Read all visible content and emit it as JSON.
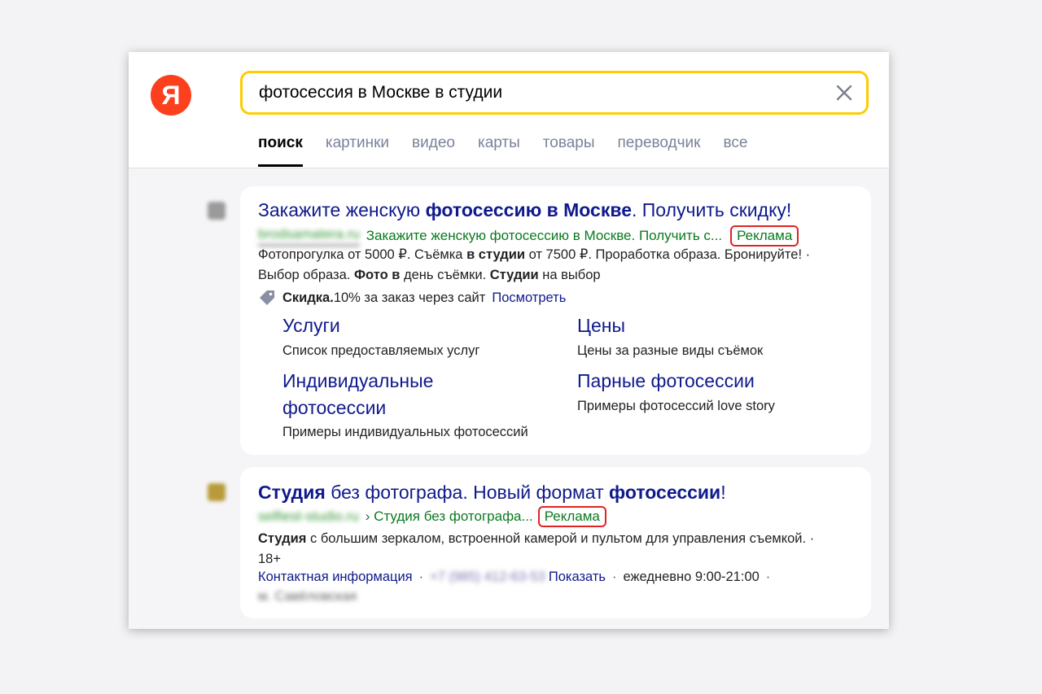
{
  "logo": {
    "letter": "Я"
  },
  "search": {
    "query": "фотосессия в Москве в студии"
  },
  "tabs": [
    {
      "label": "поиск"
    },
    {
      "label": "картинки"
    },
    {
      "label": "видео"
    },
    {
      "label": "карты"
    },
    {
      "label": "товары"
    },
    {
      "label": "переводчик"
    },
    {
      "label": "все"
    }
  ],
  "result1": {
    "title_a": "Закажите женскую ",
    "title_b": "фотосессию в Москве",
    "title_c": ". Получить скидку!",
    "domain": "brodsamatera.ru",
    "url_text": "Закажите женскую фотосессию в Москве. Получить с...",
    "badge": "Реклама",
    "snippet_a": "Фотопрогулка от 5000 ₽. Съёмка ",
    "snippet_b": "в студии",
    "snippet_c": " от 7500 ₽. Проработка образа. Бронируйте! ·",
    "snippet_d": "Выбор образа. ",
    "snippet_e": "Фото в",
    "snippet_f": " день съёмки. ",
    "snippet_g": "Студии",
    "snippet_h": " на выбор",
    "promo_bold": "Скидка.",
    "promo_text": " 10% за заказ через сайт",
    "promo_link": "Посмотреть",
    "sitelinks": [
      {
        "title": "Услуги",
        "desc": "Список предоставляемых услуг"
      },
      {
        "title": "Цены",
        "desc": "Цены за разные виды съёмок"
      },
      {
        "title": "Индивидуальные фотосессии",
        "desc": "Примеры индивидуальных фотосессий"
      },
      {
        "title": "Парные фотосессии",
        "desc": "Примеры фотосессий love story"
      }
    ]
  },
  "result2": {
    "title_a": "Студия",
    "title_b": " без фотографа. Новый формат ",
    "title_c": "фотосессии",
    "title_d": "!",
    "domain": "selfiest-studio.ru",
    "url_text": "› Студия без фотографа...",
    "badge": "Реклама",
    "snippet_a": "Студия",
    "snippet_b": " с большим зеркалом, встроенной камерой и пультом для управления съемкой. ·",
    "snippet_c": "18+",
    "contact_link": "Контактная информация",
    "phone": "+7 (985) 412-63-53",
    "show_link": "Показать",
    "hours": "ежедневно 9:00-21:00",
    "address": "м. Савёловская"
  },
  "colors": {
    "accent": "#ffcc00",
    "logo": "#fc3f1d",
    "link": "#0f1a8c",
    "url": "#0a7a1e",
    "badge_border": "#e02424"
  }
}
